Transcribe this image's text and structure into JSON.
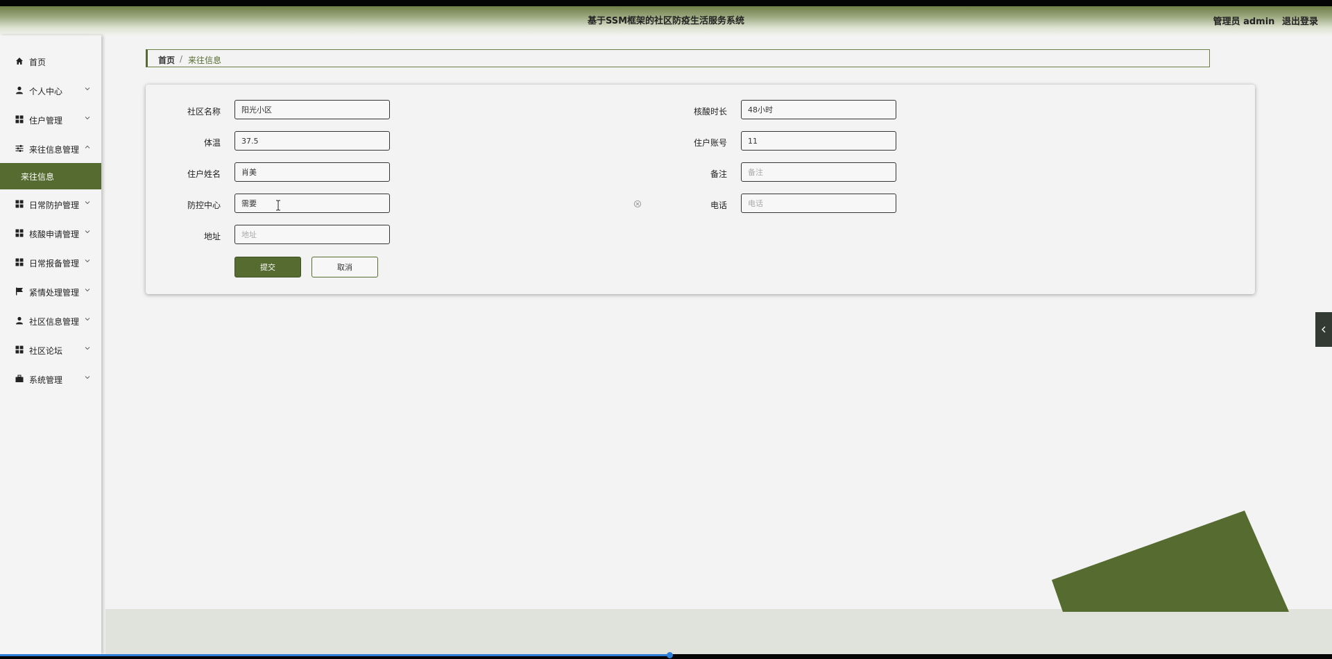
{
  "header": {
    "title": "基于SSM框架的社区防疫生活服务系统",
    "user_label": "管理员 admin",
    "logout_label": "退出登录"
  },
  "sidebar": {
    "items": [
      {
        "label": "首页",
        "icon": "home-icon"
      },
      {
        "label": "个人中心",
        "icon": "user-icon"
      },
      {
        "label": "住户管理",
        "icon": "grid-icon"
      },
      {
        "label": "来往信息管理",
        "icon": "sliders-icon",
        "expanded": true
      },
      {
        "label": "日常防护管理",
        "icon": "grid-icon"
      },
      {
        "label": "核酸申请管理",
        "icon": "grid-icon"
      },
      {
        "label": "日常报备管理",
        "icon": "grid-icon"
      },
      {
        "label": "紧情处理管理",
        "icon": "flag-icon"
      },
      {
        "label": "社区信息管理",
        "icon": "user-icon"
      },
      {
        "label": "社区论坛",
        "icon": "grid-icon"
      },
      {
        "label": "系统管理",
        "icon": "briefcase-icon"
      }
    ],
    "active_sub": "来往信息"
  },
  "breadcrumb": {
    "home": "首页",
    "separator": "/",
    "current": "来往信息"
  },
  "form": {
    "community_name": {
      "label": "社区名称",
      "value": "阳光小区",
      "placeholder": "社区名称"
    },
    "nucleic_duration": {
      "label": "核酸时长",
      "value": "48小时",
      "placeholder": "核酸时长"
    },
    "temperature": {
      "label": "体温",
      "value": "37.5",
      "placeholder": "体温"
    },
    "resident_account": {
      "label": "住户账号",
      "value": "11",
      "placeholder": "住户账号"
    },
    "resident_name": {
      "label": "住户姓名",
      "value": "肖美",
      "placeholder": "住户姓名"
    },
    "remark": {
      "label": "备注",
      "value": "",
      "placeholder": "备注"
    },
    "control_center": {
      "label": "防控中心",
      "value": "需要",
      "placeholder": "防控中心"
    },
    "phone": {
      "label": "电话",
      "value": "",
      "placeholder": "电话"
    },
    "address": {
      "label": "地址",
      "value": "",
      "placeholder": "地址"
    },
    "submit_label": "提交",
    "cancel_label": "取消"
  },
  "colors": {
    "accent": "#556b2f",
    "footer_band": "#e0e3dc",
    "progress": "#2f7fd8"
  }
}
